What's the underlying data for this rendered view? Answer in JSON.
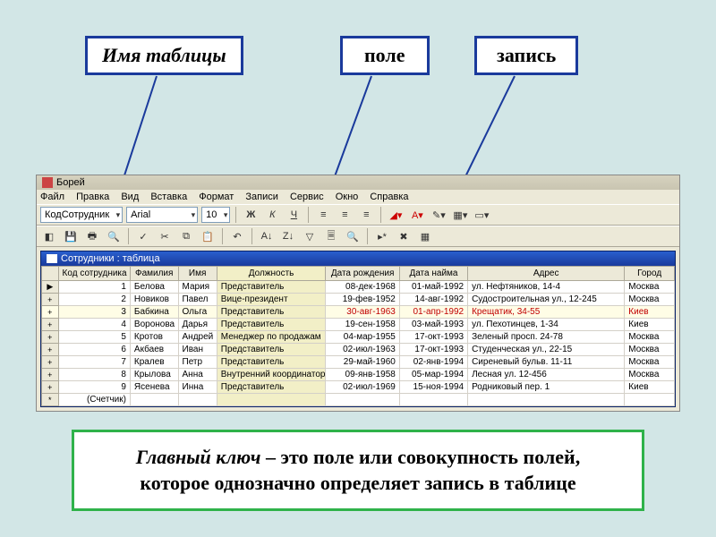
{
  "callouts": {
    "table_name": "Имя таблицы",
    "field": "поле",
    "record": "запись"
  },
  "app": {
    "title": "Борей",
    "menu": [
      "Файл",
      "Правка",
      "Вид",
      "Вставка",
      "Формат",
      "Записи",
      "Сервис",
      "Окно",
      "Справка"
    ],
    "toolbar": {
      "field_combo": "КодСотрудник",
      "font_combo": "Arial",
      "size_combo": "10",
      "bold": "Ж",
      "italic": "К",
      "underline": "Ч"
    },
    "table_title": "Сотрудники : таблица",
    "columns": [
      "",
      "Код сотрудника",
      "Фамилия",
      "Имя",
      "Должность",
      "Дата рождения",
      "Дата найма",
      "Адрес",
      "Город"
    ],
    "rows": [
      {
        "marker": "▶",
        "id": "1",
        "fam": "Белова",
        "name": "Мария",
        "pos": "Представитель",
        "birth": "08-дек-1968",
        "hire": "01-май-1992",
        "addr": "ул. Нефтяников, 14-4",
        "city": "Москва"
      },
      {
        "marker": "+",
        "id": "2",
        "fam": "Новиков",
        "name": "Павел",
        "pos": "Вице-президент",
        "birth": "19-фев-1952",
        "hire": "14-авг-1992",
        "addr": "Судостроительная ул., 12-245",
        "city": "Москва"
      },
      {
        "marker": "+",
        "id": "3",
        "fam": "Бабкина",
        "name": "Ольга",
        "pos": "Представитель",
        "birth": "30-авг-1963",
        "hire": "01-апр-1992",
        "addr": "Крещатик, 34-55",
        "city": "Киев",
        "hl": true
      },
      {
        "marker": "+",
        "id": "4",
        "fam": "Воронова",
        "name": "Дарья",
        "pos": "Представитель",
        "birth": "19-сен-1958",
        "hire": "03-май-1993",
        "addr": "ул. Пехотинцев, 1-34",
        "city": "Киев"
      },
      {
        "marker": "+",
        "id": "5",
        "fam": "Кротов",
        "name": "Андрей",
        "pos": "Менеджер по продажам",
        "birth": "04-мар-1955",
        "hire": "17-окт-1993",
        "addr": "Зеленый просп. 24-78",
        "city": "Москва"
      },
      {
        "marker": "+",
        "id": "6",
        "fam": "Акбаев",
        "name": "Иван",
        "pos": "Представитель",
        "birth": "02-июл-1963",
        "hire": "17-окт-1993",
        "addr": "Студенческая ул., 22-15",
        "city": "Москва"
      },
      {
        "marker": "+",
        "id": "7",
        "fam": "Кралев",
        "name": "Петр",
        "pos": "Представитель",
        "birth": "29-май-1960",
        "hire": "02-янв-1994",
        "addr": "Сиреневый бульв. 11-11",
        "city": "Москва"
      },
      {
        "marker": "+",
        "id": "8",
        "fam": "Крылова",
        "name": "Анна",
        "pos": "Внутренний координатор",
        "birth": "09-янв-1958",
        "hire": "05-мар-1994",
        "addr": "Лесная ул. 12-456",
        "city": "Москва"
      },
      {
        "marker": "+",
        "id": "9",
        "fam": "Ясенева",
        "name": "Инна",
        "pos": "Представитель",
        "birth": "02-июл-1969",
        "hire": "15-ноя-1994",
        "addr": "Родниковый пер. 1",
        "city": "Киев"
      },
      {
        "marker": "*",
        "id": "(Счетчик)",
        "fam": "",
        "name": "",
        "pos": "",
        "birth": "",
        "hire": "",
        "addr": "",
        "city": ""
      }
    ]
  },
  "definition": {
    "term": "Главный ключ",
    "dash": " – ",
    "text1": "это поле или совокупность полей,",
    "text2": "которое однозначно определяет запись в таблице"
  }
}
